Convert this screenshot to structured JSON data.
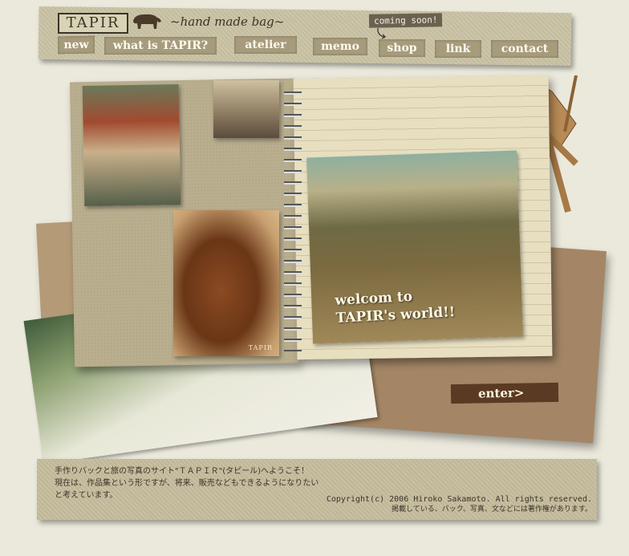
{
  "header": {
    "logo_text": "TAPIR",
    "tagline": "~hand made bag~",
    "coming_soon": "coming soon!",
    "nav": [
      {
        "label": "new"
      },
      {
        "label": "what is TAPIR?"
      },
      {
        "label": "atelier"
      },
      {
        "label": "memo"
      },
      {
        "label": "shop"
      },
      {
        "label": "link"
      },
      {
        "label": "contact"
      }
    ]
  },
  "hero": {
    "welcome_line1": "welcom to",
    "welcome_line2": "TAPIR's world!!",
    "photo_caption": "TAPIR",
    "enter_label": "enter>"
  },
  "footer": {
    "intro_line1": "手作りバックと旅の写真のサイト\"ＴＡＰＩＲ\"(タピール)へようこそ！",
    "intro_line2": "現在は、作品集という形ですが、将来、販売などもできるようになりたいと考えています。",
    "copyright": "Copyright(c) 2006 Hiroko Sakamoto. All rights reserved.",
    "notice": "掲載している、バック、写真、文などには著作権があります。"
  },
  "colors": {
    "background": "#ebe9dc",
    "header_bg": "#c9c2a4",
    "nav_button": "#a69c7c",
    "enter_button": "#5a3a22"
  }
}
